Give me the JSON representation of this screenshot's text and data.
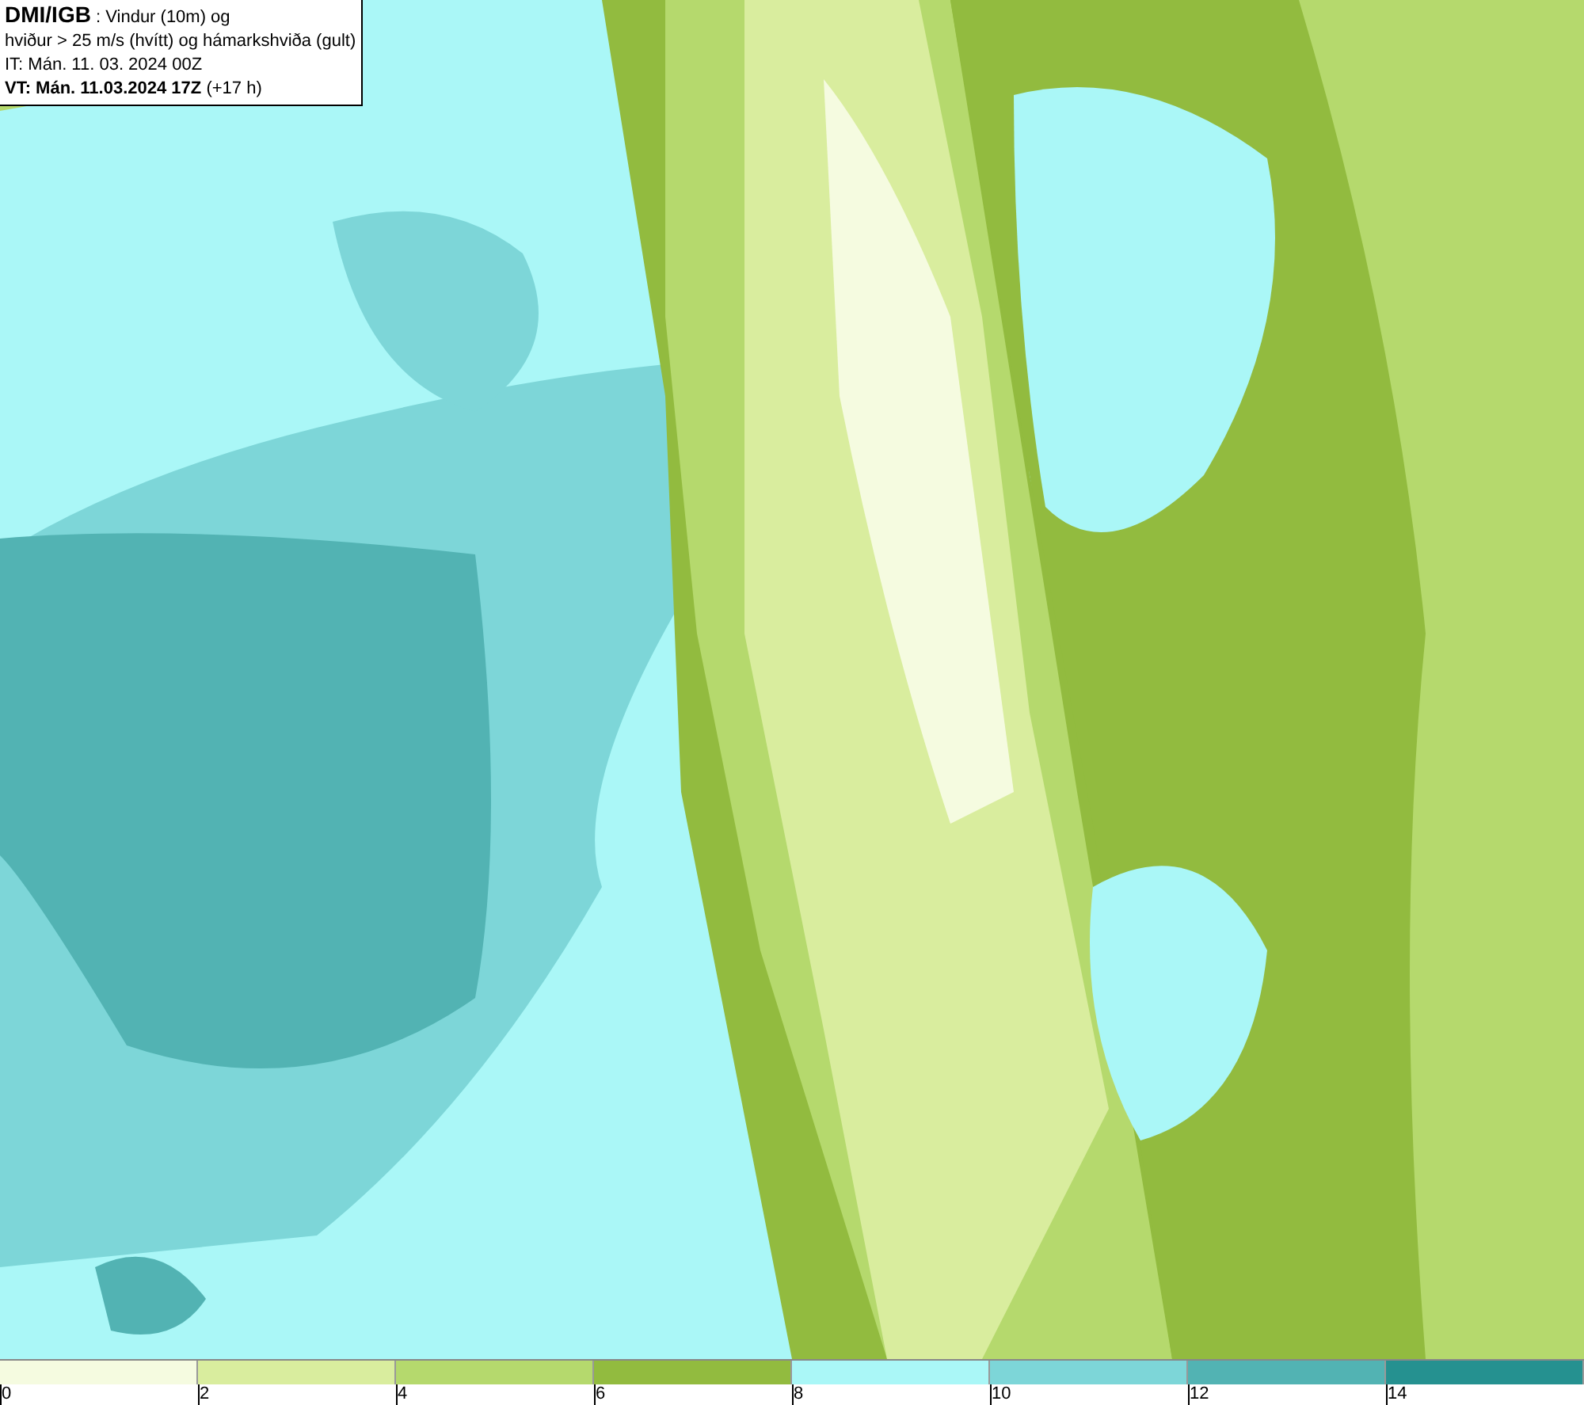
{
  "info_box": {
    "lines": [
      "**DMI/IGB** : Vindur (10m) og",
      "hviður > 25 m/s (hvítt) og hámarkshviða (gult)",
      "IT: Mán. 11. 03. 2024 00Z",
      "**VT: Mán. 11.03.2024 17Z** (+17 h)"
    ]
  },
  "legend": {
    "bins": [
      {
        "color": "#f5fbe0"
      },
      {
        "color": "#d9ed9e"
      },
      {
        "color": "#b5d96d"
      },
      {
        "color": "#92bb3f"
      },
      {
        "color": "#aaf7f7"
      },
      {
        "color": "#7dd6d8"
      },
      {
        "color": "#52b3b3"
      },
      {
        "color": "#259190"
      }
    ],
    "ticks": [
      "0",
      "2",
      "4",
      "6",
      "8",
      "10",
      "12",
      "14"
    ]
  }
}
